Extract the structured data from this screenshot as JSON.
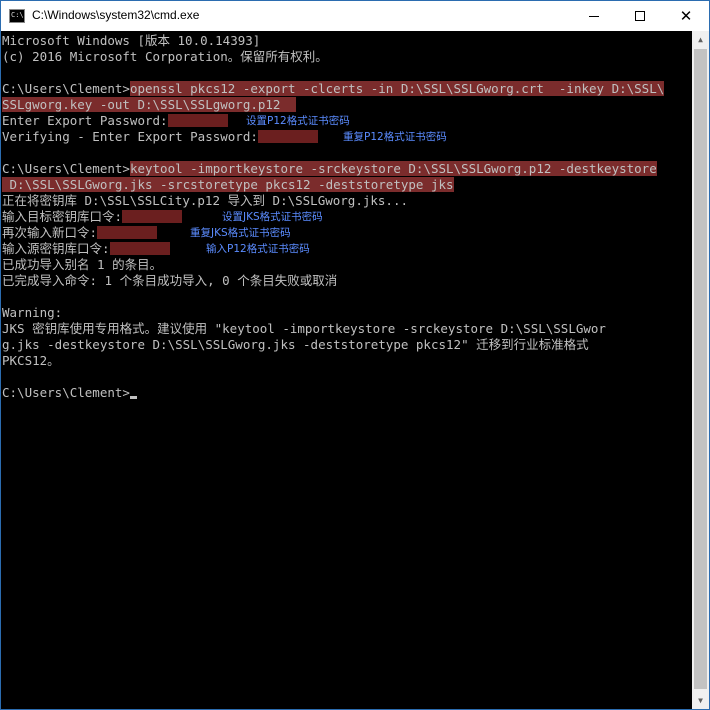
{
  "window": {
    "title": "C:\\Windows\\system32\\cmd.exe",
    "icon_text": "C:\\",
    "close_glyph": "✕"
  },
  "console": {
    "l1": "Microsoft Windows [版本 10.0.14393]",
    "l2": "(c) 2016 Microsoft Corporation。保留所有权利。",
    "l3_prompt": "C:\\Users\\Clement>",
    "l3_cmd": "openssl pkcs12 -export -clcerts -in D:\\SSL\\SSLGworg.crt  -inkey D:\\SSL\\",
    "l4_cmd": "SSLgworg.key -out D:\\SSL\\SSLgworg.p12  ",
    "l5": "Enter Export Password:",
    "l5_note": "设置P12格式证书密码",
    "l6": "Verifying - Enter Export Password:",
    "l6_note": "重复P12格式证书密码",
    "l7_prompt": "C:\\Users\\Clement>",
    "l7_cmd": "keytool -importkeystore -srckeystore D:\\SSL\\SSLGworg.p12 -destkeystore",
    "l8_cmd": " D:\\SSL\\SSLGworg.jks -srcstoretype pkcs12 -deststoretype jks",
    "l9": "正在将密钥库 D:\\SSL\\SSLCity.p12 导入到 D:\\SSLGworg.jks...",
    "l10": "输入目标密钥库口令:",
    "l10_note": "设置JKS格式证书密码",
    "l11": "再次输入新口令:",
    "l11_note": "重复JKS格式证书密码",
    "l12": "输入源密钥库口令:",
    "l12_note": "输入P12格式证书密码",
    "l13": "已成功导入别名 1 的条目。",
    "l14": "已完成导入命令: 1 个条目成功导入, 0 个条目失败或取消",
    "l15": "Warning:",
    "l16": "JKS 密钥库使用专用格式。建议使用 \"keytool -importkeystore -srckeystore D:\\SSL\\SSLGwor",
    "l17": "g.jks -destkeystore D:\\SSL\\SSLGworg.jks -deststoretype pkcs12\" 迁移到行业标准格式",
    "l18": "PKCS12。",
    "l19_prompt": "C:\\Users\\Clement>"
  },
  "colors": {
    "background": "#000000",
    "text": "#c0c0c0",
    "highlight": "#7b2c2c",
    "annotation": "#5b8cff"
  }
}
